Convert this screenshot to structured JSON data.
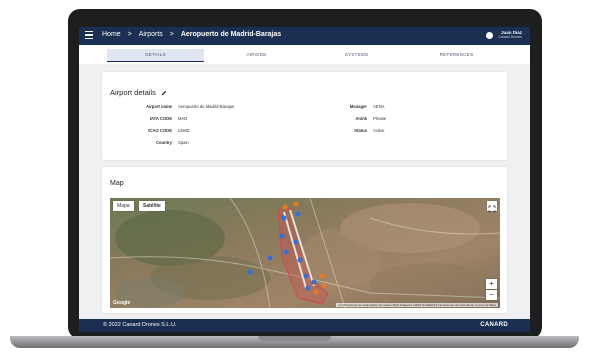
{
  "header": {
    "breadcrumb": [
      "Home",
      "Airports",
      "Aeropuerto de Madrid-Barajas"
    ],
    "separator": ">",
    "user_name": "Juan Diaz",
    "user_company": "Canard Drones"
  },
  "tabs": [
    {
      "label": "DETAILS",
      "active": true
    },
    {
      "label": "AIRSIDE",
      "active": false
    },
    {
      "label": "SYSTEMS",
      "active": false
    },
    {
      "label": "REFERENCES",
      "active": false
    }
  ],
  "details": {
    "title": "Airport details",
    "left": [
      {
        "label": "Airport name",
        "value": "Aeropuerto de Madrid-Barajas"
      },
      {
        "label": "IATA CODE",
        "value": "MAD"
      },
      {
        "label": "ICAO CODE",
        "value": "LEMD"
      },
      {
        "label": "Country",
        "value": "Spain"
      }
    ],
    "right": [
      {
        "label": "Manager",
        "value": "AENA"
      },
      {
        "label": "Anink",
        "value": "Private"
      },
      {
        "label": "Status",
        "value": "Active"
      }
    ]
  },
  "map": {
    "title": "Map",
    "type_buttons": [
      "Mapa",
      "Satélite"
    ],
    "selected_type": "Satélite",
    "zoom_in": "+",
    "zoom_out": "−",
    "logo": "Google",
    "attribution": "Combinaciones de teclas   Datos del mapa ©2022   Imágenes ©2022 TerraMetrics   Términos de uso   Informar de un error de Maps"
  },
  "footer": {
    "copyright": "© 2022 Canard Drones S.L.U.",
    "brand": "CANARD"
  },
  "colors": {
    "primary": "#1a2f52",
    "tab_active_bg": "#dfe6f1",
    "marker_blue": "#3d6fd1",
    "marker_orange": "#e07b24",
    "zone_red": "#d04a4a"
  }
}
